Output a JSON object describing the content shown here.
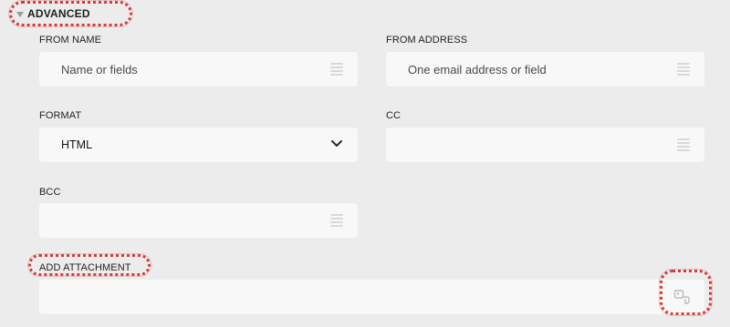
{
  "section": {
    "title": "ADVANCED",
    "expanded": true
  },
  "fields": {
    "from_name": {
      "label": "FROM NAME",
      "placeholder": "Name or fields",
      "icon": "list-icon"
    },
    "from_address": {
      "label": "FROM ADDRESS",
      "placeholder": "One email address or field",
      "icon": "list-icon"
    },
    "format": {
      "label": "FORMAT",
      "value": "HTML",
      "icon": "chevron-down-icon"
    },
    "cc": {
      "label": "CC",
      "placeholder": "",
      "icon": "list-icon"
    },
    "bcc": {
      "label": "BCC",
      "placeholder": "",
      "icon": "list-icon"
    },
    "attachment": {
      "label": "ADD ATTACHMENT",
      "placeholder": "",
      "icon": "attachment-picker-icon"
    }
  },
  "colors": {
    "background": "#ececed",
    "input_background": "#f8f8f9",
    "highlight": "#d43a3a"
  }
}
